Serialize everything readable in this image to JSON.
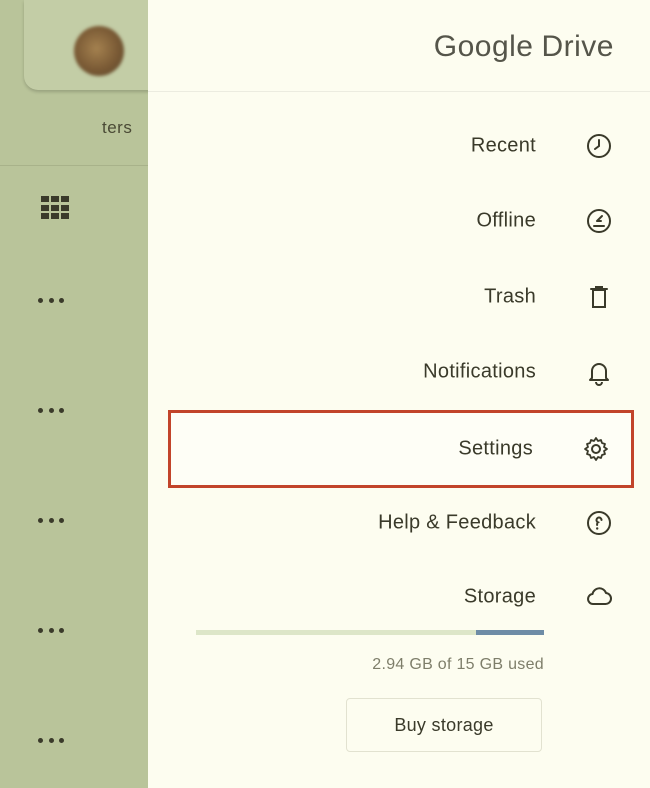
{
  "background": {
    "filter_chip_label": "ters",
    "icons": {
      "avatar": "avatar",
      "grid": "grid-view-icon",
      "more": "more-horizontal-icon"
    }
  },
  "drawer": {
    "brand": {
      "word1": "Google",
      "word2": "Drive"
    },
    "items": [
      {
        "label": "Recent",
        "icon": "clock-icon"
      },
      {
        "label": "Offline",
        "icon": "offline-icon"
      },
      {
        "label": "Trash",
        "icon": "trash-icon"
      },
      {
        "label": "Notifications",
        "icon": "bell-icon"
      },
      {
        "label": "Settings",
        "icon": "gear-icon",
        "selected": true
      },
      {
        "label": "Help & Feedback",
        "icon": "help-icon"
      },
      {
        "label": "Storage",
        "icon": "cloud-icon"
      }
    ],
    "storage": {
      "used_text": "2.94 GB of 15 GB used",
      "used_fraction": 0.196
    },
    "buy_storage_label": "Buy storage"
  },
  "colors": {
    "background_app": "#b9c49a",
    "drawer": "#fdfdf0",
    "selected_outline": "#c2442a",
    "storage_fill": "#6e8ca6"
  }
}
